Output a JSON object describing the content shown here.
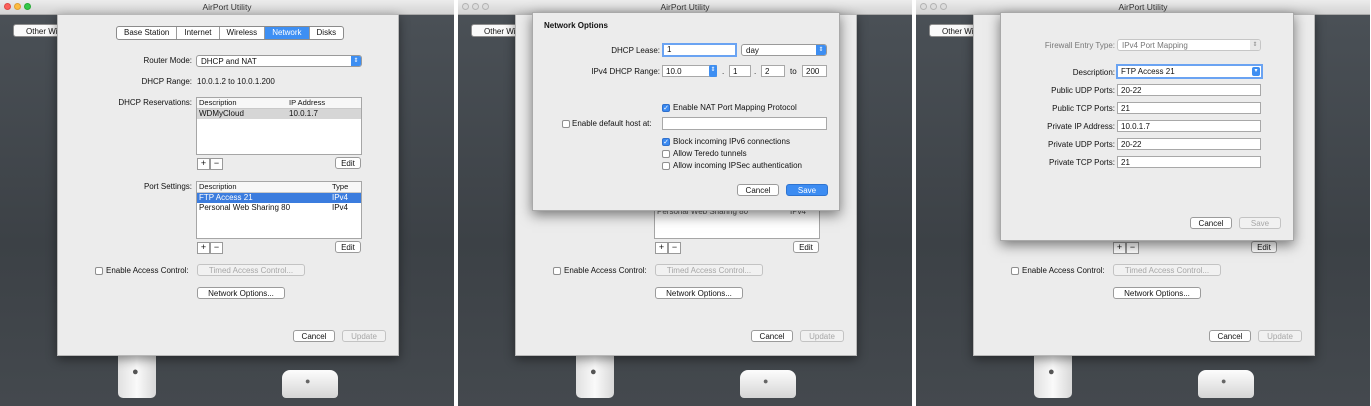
{
  "app": {
    "title": "AirPort Utility",
    "other_button": "Other Wi-Fi Devices"
  },
  "main": {
    "tabs": [
      {
        "label": "Base Station"
      },
      {
        "label": "Internet"
      },
      {
        "label": "Wireless"
      },
      {
        "label": "Network",
        "selected": true
      },
      {
        "label": "Disks"
      }
    ],
    "router_mode": {
      "label": "Router Mode:",
      "value": "DHCP and NAT"
    },
    "dhcp_range": {
      "label": "DHCP Range:",
      "value": "10.0.1.2 to 10.0.1.200"
    },
    "dhcp_reservations": {
      "label": "DHCP Reservations:",
      "columns": [
        "Description",
        "IP Address"
      ],
      "rows": [
        {
          "description": "WDMyCloud",
          "ip": "10.0.1.7"
        }
      ]
    },
    "port_settings": {
      "label": "Port Settings:",
      "columns": [
        "Description",
        "Type"
      ],
      "rows": [
        {
          "description": "FTP Access 21",
          "type": "IPv4"
        },
        {
          "description": "Personal Web Sharing 80",
          "type": "IPv4"
        }
      ]
    },
    "plus_label": "+",
    "minus_label": "−",
    "edit_label": "Edit",
    "access_control": {
      "label": "Enable Access Control:",
      "checked": false,
      "timed_button": "Timed Access Control..."
    },
    "network_options_button": "Network Options...",
    "cancel_label": "Cancel",
    "update_label": "Update"
  },
  "network_options": {
    "title": "Network Options",
    "dhcp_lease": {
      "label": "DHCP Lease:",
      "value": "1",
      "unit": "day"
    },
    "ipv4_range": {
      "label": "IPv4 DHCP Range:",
      "prefix": "10.0",
      "oct2": "1",
      "oct3": "2",
      "to_label": "to",
      "end": "200"
    },
    "nat_pmp": {
      "label": "Enable NAT Port Mapping Protocol",
      "checked": true
    },
    "default_host": {
      "label": "Enable default host at:",
      "checked": false,
      "value": ""
    },
    "block_ipv6": {
      "label": "Block incoming IPv6 connections",
      "checked": true
    },
    "teredo": {
      "label": "Allow Teredo tunnels",
      "checked": false
    },
    "ipsec": {
      "label": "Allow incoming IPSec authentication",
      "checked": false
    },
    "cancel_label": "Cancel",
    "save_label": "Save",
    "partial_row_text": "Personal Web Sharing 80",
    "partial_type_text": "IPv4"
  },
  "firewall_entry": {
    "type_label": "Firewall Entry Type:",
    "type_value": "IPv4 Port Mapping",
    "fields": [
      {
        "label": "Description:",
        "value": "FTP Access 21",
        "focused": true
      },
      {
        "label": "Public UDP Ports:",
        "value": "20-22"
      },
      {
        "label": "Public TCP Ports:",
        "value": "21"
      },
      {
        "label": "Private IP Address:",
        "value": "10.0.1.7"
      },
      {
        "label": "Private UDP Ports:",
        "value": "20-22"
      },
      {
        "label": "Private TCP Ports:",
        "value": "21"
      }
    ],
    "cancel_label": "Cancel",
    "save_label": "Save"
  },
  "colors": {
    "accent": "#3e8ff3",
    "selection": "#3b7cde",
    "background": "#44494e"
  }
}
